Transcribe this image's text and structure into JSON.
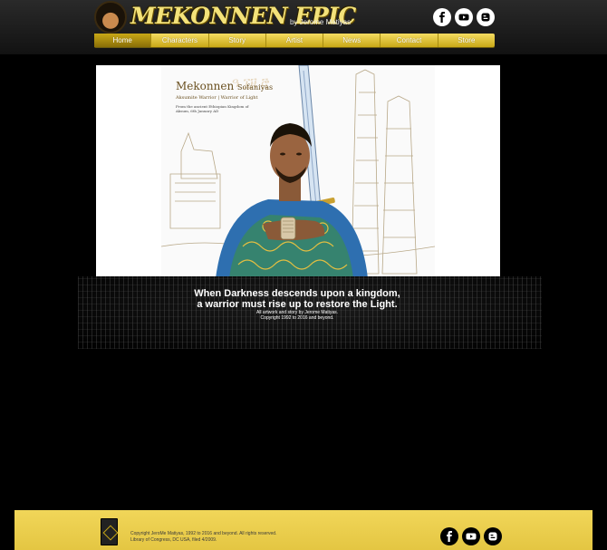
{
  "header": {
    "logo_text": "MEKONNEN EPIC",
    "byline": "by Jerome Matiyas"
  },
  "social_icons": [
    "facebook-icon",
    "youtube-icon",
    "blogger-icon"
  ],
  "nav": {
    "items": [
      {
        "label": "Home",
        "active": true
      },
      {
        "label": "Characters",
        "active": false
      },
      {
        "label": "Story",
        "active": false
      },
      {
        "label": "Artist",
        "active": false
      },
      {
        "label": "News",
        "active": false
      },
      {
        "label": "Contact",
        "active": false
      },
      {
        "label": "Store",
        "active": false
      }
    ]
  },
  "hero": {
    "title": "Mekonnen",
    "title_suffix": "Sofaniyas",
    "subtitle": "Aksumite Warrior | Warrior of Light",
    "note": "From the ancient Ethiopian Kingdom of Aksum, 6th January AD"
  },
  "tagline": {
    "line1": "When Darkness descends upon a kingdom,",
    "line2": "a warrior must rise up to restore the Light.",
    "credit1": "All artwork and story by Jerome Matiyas.",
    "credit2": "Copyright 1992 to 2016 and beyond."
  },
  "footer": {
    "copyright1": "Copyright JeroMe Matiyas, 1992 to 2016 and beyond. All rights reserved.",
    "copyright2": "Library of Congress, DC USA, filed 4/2009."
  },
  "colors": {
    "gold": "#e4c642",
    "nav_active": "#8a6f07",
    "background": "#000000"
  }
}
